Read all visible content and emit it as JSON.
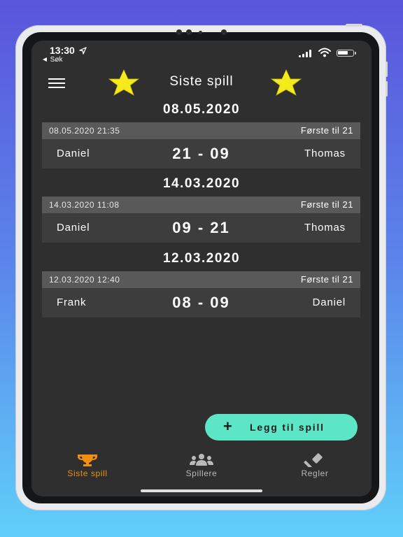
{
  "status_bar": {
    "time": "13:30",
    "back": "◄ Søk"
  },
  "header": {
    "title": "Siste spill"
  },
  "games": [
    {
      "date": "08.05.2020",
      "timestamp": "08.05.2020 21:35",
      "mode": "Første til 21",
      "player1": "Daniel",
      "score": "21 - 09",
      "player2": "Thomas"
    },
    {
      "date": "14.03.2020",
      "timestamp": "14.03.2020 11:08",
      "mode": "Første til 21",
      "player1": "Daniel",
      "score": "09 - 21",
      "player2": "Thomas"
    },
    {
      "date": "12.03.2020",
      "timestamp": "12.03.2020 12:40",
      "mode": "Første til 21",
      "player1": "Frank",
      "score": "08 - 09",
      "player2": "Daniel"
    }
  ],
  "fab": {
    "label": "Legg til spill"
  },
  "tabs": [
    {
      "label": "Siste spill",
      "icon": "trophy-icon"
    },
    {
      "label": "Spillere",
      "icon": "players-icon"
    },
    {
      "label": "Regler",
      "icon": "gavel-icon"
    }
  ],
  "colors": {
    "accent_active": "#f0900e",
    "fab": "#5de6c6",
    "inactive": "#b9b9b9",
    "star": "#f5ea1c"
  }
}
